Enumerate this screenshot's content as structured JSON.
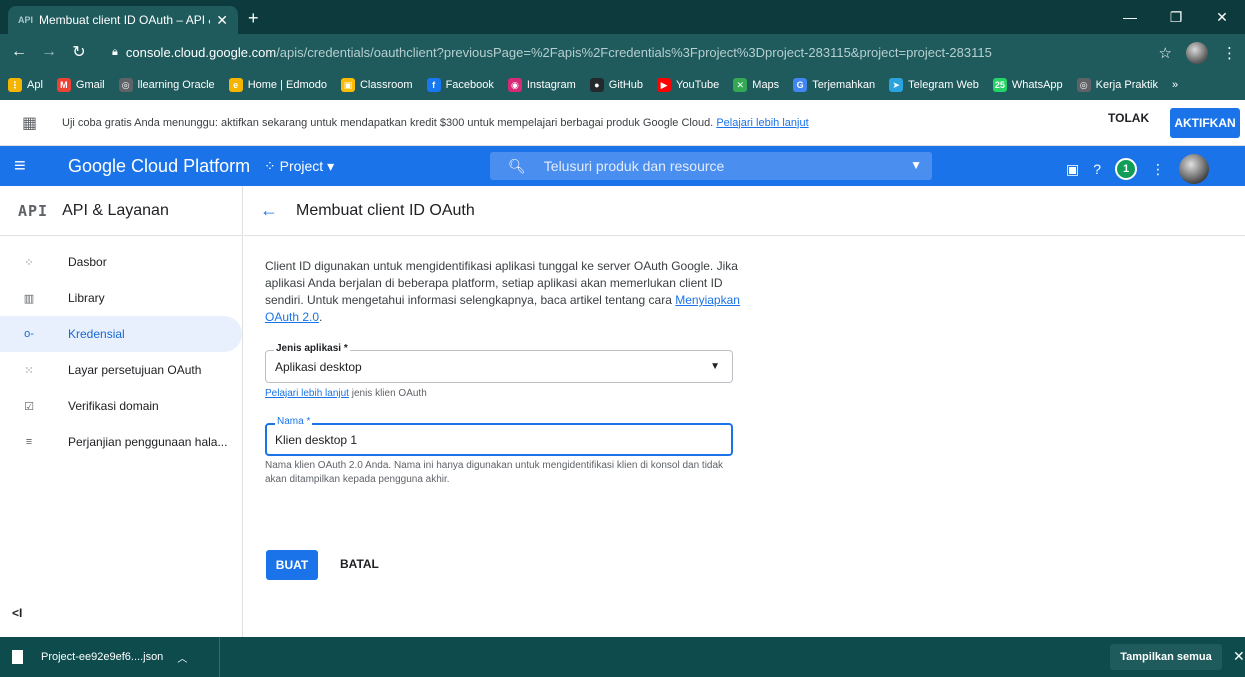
{
  "browser": {
    "tab_favicon": "API",
    "tab_title": "Membuat client ID OAuth – API &",
    "tab_close": "✕",
    "new_tab": "+",
    "url_host": "console.cloud.google.com",
    "url_path": "/apis/credentials/oauthclient?previousPage=%2Fapis%2Fcredentials%3Fproject%3Dproject-283115&project=project-283115",
    "bookmarks": [
      {
        "label": "Apl",
        "color": "#f4b400",
        "icon": "apps-grid-icon",
        "glyph": "⋮"
      },
      {
        "label": "Gmail",
        "color": "#ea4335",
        "icon": "gmail-icon",
        "glyph": "M"
      },
      {
        "label": "llearning Oracle",
        "color": "#5f6368",
        "icon": "globe-icon",
        "glyph": "◎"
      },
      {
        "label": "Home | Edmodo",
        "color": "#f4b400",
        "icon": "edmodo-icon",
        "glyph": "e"
      },
      {
        "label": "Classroom",
        "color": "#fbbc04",
        "icon": "classroom-icon",
        "glyph": "▣"
      },
      {
        "label": "Facebook",
        "color": "#1877f2",
        "icon": "facebook-icon",
        "glyph": "f"
      },
      {
        "label": "Instagram",
        "color": "#d62976",
        "icon": "instagram-icon",
        "glyph": "◉"
      },
      {
        "label": "GitHub",
        "color": "#24292e",
        "icon": "github-icon",
        "glyph": "●"
      },
      {
        "label": "YouTube",
        "color": "#ff0000",
        "icon": "youtube-icon",
        "glyph": "▶"
      },
      {
        "label": "Maps",
        "color": "#34a853",
        "icon": "maps-icon",
        "glyph": "✕"
      },
      {
        "label": "Terjemahkan",
        "color": "#4285f4",
        "icon": "translate-icon",
        "glyph": "G"
      },
      {
        "label": "Telegram Web",
        "color": "#2aa3df",
        "icon": "telegram-icon",
        "glyph": "➤"
      },
      {
        "label": "WhatsApp",
        "color": "#25d366",
        "icon": "whatsapp-icon",
        "glyph": "25"
      },
      {
        "label": "Kerja Praktik",
        "color": "#5f6368",
        "icon": "globe-icon",
        "glyph": "◎"
      }
    ]
  },
  "banner": {
    "message": "Uji coba gratis Anda menunggu: aktifkan sekarang untuk mendapatkan kredit $300 untuk mempelajari berbagai produk Google Cloud.",
    "link": "Pelajari lebih lanjut",
    "dismiss": "TOLAK",
    "activate": "AKTIFKAN"
  },
  "header": {
    "brand": "Google Cloud Platform",
    "project": "Project ▾",
    "search_placeholder": "Telusuri produk dan resource",
    "notifications": "1"
  },
  "sidebar": {
    "title_badge": "API",
    "title": "API & Layanan",
    "items": [
      {
        "label": "Dasbor",
        "glyph": "⁘",
        "active": false
      },
      {
        "label": "Library",
        "glyph": "▥",
        "active": false
      },
      {
        "label": "Kredensial",
        "glyph": "o-",
        "active": true
      },
      {
        "label": "Layar persetujuan OAuth",
        "glyph": "⁙",
        "active": false
      },
      {
        "label": "Verifikasi domain",
        "glyph": "☑",
        "active": false
      },
      {
        "label": "Perjanjian penggunaan hala...",
        "glyph": "≡",
        "active": false
      }
    ],
    "collapse": "<I"
  },
  "main": {
    "title": "Membuat client ID OAuth",
    "description": "Client ID digunakan untuk mengidentifikasi aplikasi tunggal ke server OAuth Google. Jika aplikasi Anda berjalan di beberapa platform, setiap aplikasi akan memerlukan client ID sendiri. Untuk mengetahui informasi selengkapnya, baca artikel tentang cara",
    "description_link": "Menyiapkan OAuth 2.0",
    "app_type_label": "Jenis aplikasi *",
    "app_type_value": "Aplikasi desktop",
    "app_type_hint_link": "Pelajari lebih lanjut",
    "app_type_hint": " jenis klien OAuth",
    "name_label": "Nama *",
    "name_value": "Klien desktop 1",
    "name_hint": "Nama klien OAuth 2.0 Anda. Nama ini hanya digunakan untuk mengidentifikasi klien di konsol dan tidak akan ditampilkan kepada pengguna akhir.",
    "create": "BUAT",
    "cancel": "BATAL"
  },
  "downloads": {
    "file": "Project-ee92e9ef6....json",
    "show_all": "Tampilkan semua"
  }
}
